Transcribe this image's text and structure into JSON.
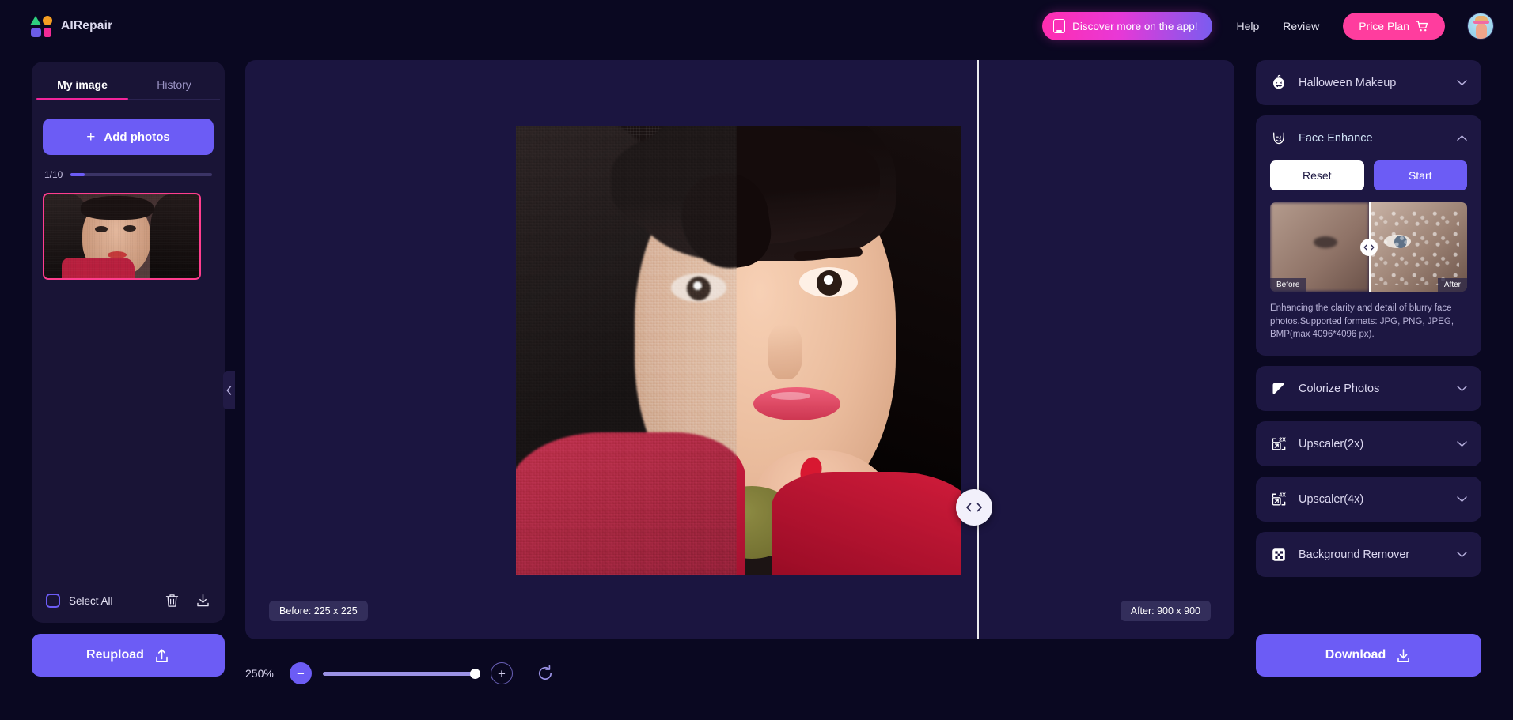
{
  "app": {
    "name": "AIRepair"
  },
  "header": {
    "discover_label": "Discover more on the app!",
    "help_label": "Help",
    "review_label": "Review",
    "price_plan_label": "Price Plan",
    "accent_pink": "#ff3d9e",
    "accent_purple": "#6c5cf5"
  },
  "sidebar": {
    "tabs": [
      {
        "label": "My image",
        "active": true
      },
      {
        "label": "History",
        "active": false
      }
    ],
    "add_photos_label": "Add photos",
    "add_photos_plus": "+",
    "count_label": "1/10",
    "count_percent": 10,
    "select_all_label": "Select All",
    "select_all_checked": false,
    "delete_icon": "trash-icon",
    "download_icon": "download-icon",
    "reupload_label": "Reupload"
  },
  "canvas": {
    "before_badge": "Before: 225 x 225",
    "after_badge": "After: 900 x 900",
    "divider_icon": "compare-slider-icon"
  },
  "zoom": {
    "percent_label": "250%",
    "minus_label": "−",
    "plus_label": "+",
    "slider_value": 100,
    "reset_icon": "refresh-icon"
  },
  "right_panel": {
    "items": [
      {
        "label": "Halloween Makeup",
        "icon": "pumpkin-icon",
        "expanded": false
      },
      {
        "label": "Face Enhance",
        "icon": "face-enhance-icon",
        "expanded": true
      },
      {
        "label": "Colorize Photos",
        "icon": "colorize-icon",
        "expanded": false
      },
      {
        "label": "Upscaler(2x)",
        "icon": "upscale-2x-icon",
        "expanded": false
      },
      {
        "label": "Upscaler(4x)",
        "icon": "upscale-4x-icon",
        "expanded": false
      },
      {
        "label": "Background Remover",
        "icon": "checkerboard-icon",
        "expanded": false
      }
    ],
    "face_enhance": {
      "reset_label": "Reset",
      "start_label": "Start",
      "before_tag": "Before",
      "after_tag": "After",
      "description": "Enhancing the clarity and detail of blurry face photos.Supported formats: JPG, PNG, JPEG, BMP(max 4096*4096 px)."
    },
    "download_label": "Download"
  }
}
